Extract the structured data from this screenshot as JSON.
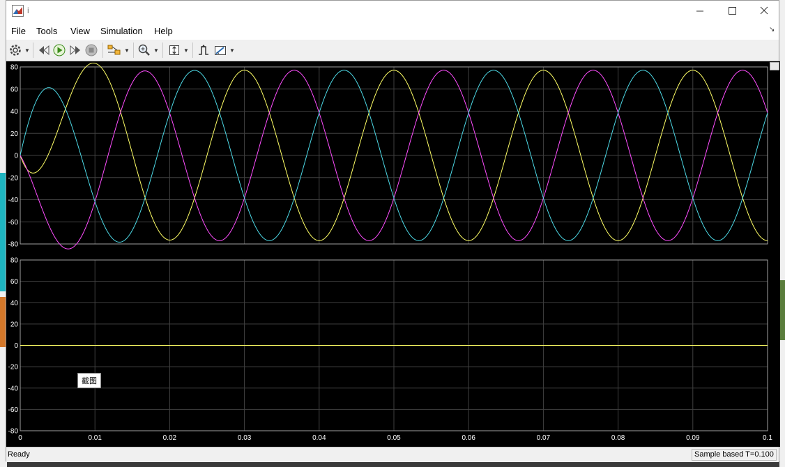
{
  "window": {
    "title": "i"
  },
  "menu": {
    "items": [
      "File",
      "Tools",
      "View",
      "Simulation",
      "Help"
    ]
  },
  "toolbar": {
    "icons": [
      "gear-icon",
      "step-back-icon",
      "run-icon",
      "step-forward-icon",
      "stop-icon",
      "signal-select-icon",
      "zoom-icon",
      "fit-axes-icon",
      "triggers-icon",
      "measurements-icon"
    ]
  },
  "colors": {
    "background": "#000000",
    "axes_border": "#a0a0a0",
    "grid": "#404040",
    "phase_a": "#ffff66",
    "phase_b": "#ff4dff",
    "phase_c": "#4dd9e6"
  },
  "chart_data": [
    {
      "type": "line",
      "xlim": [
        0,
        0.1
      ],
      "ylim": [
        -80,
        80
      ],
      "x_ticks": [
        "0",
        "0.01",
        "0.02",
        "0.03",
        "0.04",
        "0.05",
        "0.06",
        "0.07",
        "0.08",
        "0.09",
        "0.1"
      ],
      "y_ticks": [
        "80",
        "60",
        "40",
        "20",
        "0",
        "-20",
        "-40",
        "-60",
        "-80"
      ],
      "grid": true,
      "series": [
        {
          "color": "#ffff66",
          "amplitude": 77,
          "frequency_hz": 50,
          "phase_deg": -90,
          "transient_tau": 0.004
        },
        {
          "color": "#ff4dff",
          "amplitude": 77,
          "frequency_hz": 50,
          "phase_deg": 150,
          "transient_tau": 0.004
        },
        {
          "color": "#4dd9e6",
          "amplitude": 77,
          "frequency_hz": 50,
          "phase_deg": 30,
          "transient_tau": 0.004
        }
      ]
    },
    {
      "type": "line",
      "xlim": [
        0,
        0.1
      ],
      "ylim": [
        -80,
        80
      ],
      "x_ticks": [
        "0",
        "0.01",
        "0.02",
        "0.03",
        "0.04",
        "0.05",
        "0.06",
        "0.07",
        "0.08",
        "0.09",
        "0.1"
      ],
      "y_ticks": [
        "80",
        "60",
        "40",
        "20",
        "0",
        "-20",
        "-40",
        "-60",
        "-80"
      ],
      "grid": true,
      "series": [
        {
          "color": "#ffff66",
          "constant": 0
        }
      ]
    }
  ],
  "tooltip": "截图",
  "status": {
    "left": "Ready",
    "right": "Sample based  T=0.100"
  }
}
